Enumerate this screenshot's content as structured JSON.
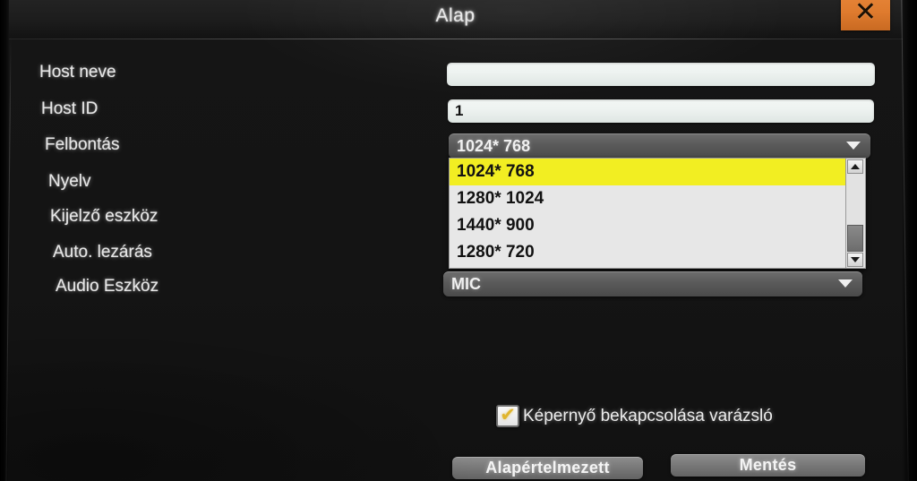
{
  "window": {
    "title": "Alap",
    "close_icon": "close-icon",
    "close_label": "✕"
  },
  "form": {
    "fields": [
      {
        "label": "Host neve",
        "type": "text",
        "value": "",
        "placeholder": ""
      },
      {
        "label": "Host ID",
        "type": "text",
        "value": "1",
        "placeholder": ""
      },
      {
        "label": "Felbontás",
        "type": "combo",
        "value": "1024* 768"
      },
      {
        "label": "Nyelv",
        "type": "hidden",
        "value": ""
      },
      {
        "label": "Kijelző eszköz",
        "type": "hidden",
        "value": ""
      },
      {
        "label": "Auto. lezárás",
        "type": "hidden",
        "value": ""
      },
      {
        "label": "Audio Eszköz",
        "type": "combo",
        "value": "MIC"
      }
    ]
  },
  "resolution_dropdown": {
    "open": true,
    "selected": "1024* 768",
    "options": [
      "1024* 768",
      "1280* 1024",
      "1440* 900",
      "1280* 720"
    ],
    "scrollbar": {
      "up_icon": "scroll-up-arrow-icon",
      "down_icon": "scroll-down-arrow-icon"
    }
  },
  "wizard": {
    "checked": true,
    "check_glyph": "✔",
    "label": "Képernyő bekapcsolása varázsló"
  },
  "buttons": {
    "default_label": "Alapértelmezett",
    "save_label": "Mentés"
  },
  "colors": {
    "accent_close": "#df7b2e",
    "highlight_row": "#f2ee22",
    "check_mark": "#e0b52e",
    "dialog_bg": "#141414"
  }
}
